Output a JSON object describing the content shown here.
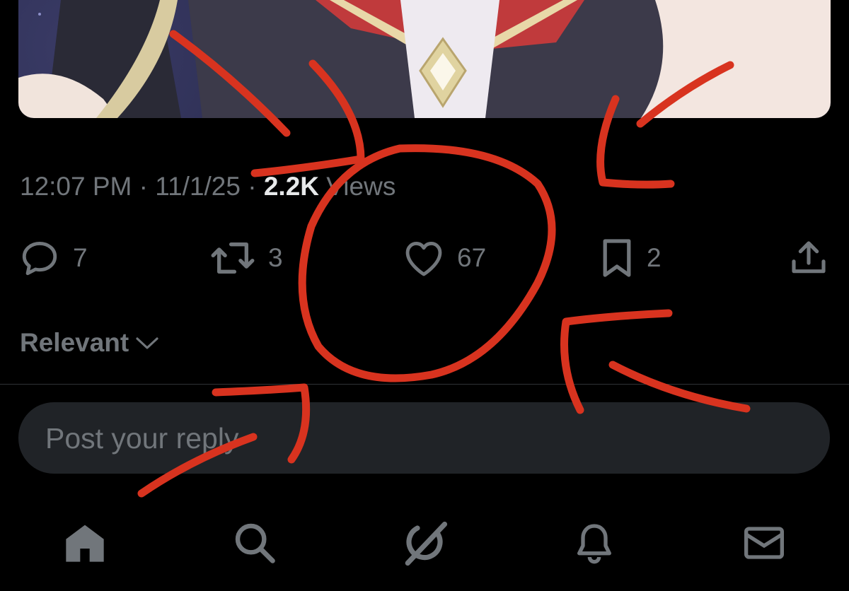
{
  "tweet": {
    "time": "12:07 PM",
    "separator": "·",
    "date": "11/1/25",
    "views_count": "2.2K",
    "views_label": "Views"
  },
  "actions": {
    "reply": {
      "icon": "reply-icon",
      "count": "7"
    },
    "repost": {
      "icon": "repost-icon",
      "count": "3"
    },
    "like": {
      "icon": "heart-icon",
      "count": "67"
    },
    "bookmark": {
      "icon": "bookmark-icon",
      "count": "2"
    },
    "share": {
      "icon": "share-icon"
    }
  },
  "replies": {
    "sort_label": "Relevant",
    "input_placeholder": "Post your reply"
  },
  "tabbar": [
    {
      "name": "Home",
      "icon": "home-icon"
    },
    {
      "name": "Search",
      "icon": "search-icon"
    },
    {
      "name": "Grok",
      "icon": "grok-icon"
    },
    {
      "name": "Notifications",
      "icon": "bell-icon"
    },
    {
      "name": "Messages",
      "icon": "mail-icon"
    }
  ],
  "colors": {
    "background": "#000000",
    "muted_text": "#71767b",
    "primary_text": "#e7e9ea",
    "reply_box": "#202327",
    "annotation": "#d8331f"
  }
}
